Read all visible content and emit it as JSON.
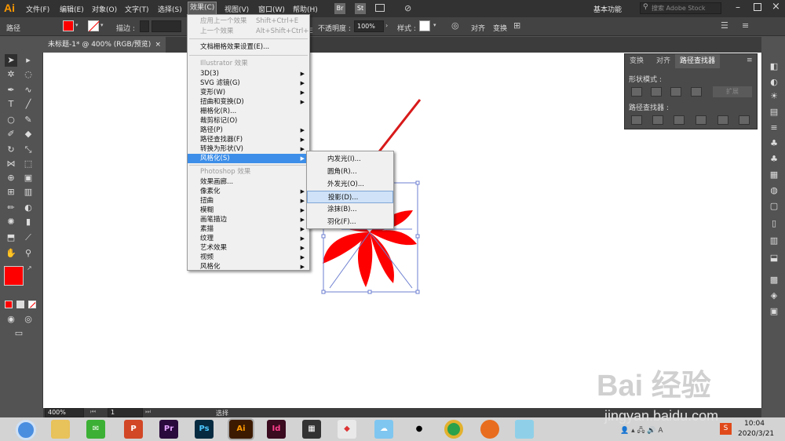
{
  "app": {
    "logo": "Ai"
  },
  "menubar": {
    "items": [
      "文件(F)",
      "编辑(E)",
      "对象(O)",
      "文字(T)",
      "选择(S)",
      "效果(C)",
      "视图(V)",
      "窗口(W)",
      "帮助(H)"
    ],
    "bridge_br": "Br",
    "bridge_st": "St",
    "workspace": "基本功能",
    "search_placeholder": "搜索 Adobe Stock"
  },
  "control": {
    "label": "路径",
    "stroke_label": "描边 :",
    "opacity_label": "不透明度 :",
    "opacity_value": "100%",
    "style_label": "样式 :",
    "align_label": "对齐",
    "transform_label": "变换",
    "fill_color": "#ff0000"
  },
  "document": {
    "tab_title": "未标题-1* @ 400% (RGB/预览)",
    "close": "×"
  },
  "effect_menu": {
    "apply_last": "应用上一个效果",
    "apply_last_sc": "Shift+Ctrl+E",
    "last": "上一个效果",
    "last_sc": "Alt+Shift+Ctrl+E",
    "raster_settings": "文档栅格效果设置(E)...",
    "illustrator_header": "Illustrator 效果",
    "illustrator_items": [
      "3D(3)",
      "SVG 滤镜(G)",
      "变形(W)",
      "扭曲和变换(D)",
      "栅格化(R)...",
      "裁剪标记(O)",
      "路径(P)",
      "路径查找器(F)",
      "转换为形状(V)",
      "风格化(S)"
    ],
    "photoshop_header": "Photoshop 效果",
    "photoshop_items": [
      "效果画廊...",
      "像素化",
      "扭曲",
      "模糊",
      "画笔描边",
      "素描",
      "纹理",
      "艺术效果",
      "视频",
      "风格化"
    ]
  },
  "stylize_submenu": {
    "items": [
      "内发光(I)...",
      "圆角(R)...",
      "外发光(O)...",
      "投影(D)...",
      "涂抹(B)...",
      "羽化(F)..."
    ]
  },
  "pathfinder_panel": {
    "tabs": [
      "变换",
      "对齐",
      "路径查找器"
    ],
    "shape_modes": "形状模式 :",
    "expand": "扩展",
    "pathfinders": "路径查找器 :"
  },
  "statusbar": {
    "zoom": "400%",
    "page": "1",
    "tool": "选择"
  },
  "taskbar": {
    "time": "10:04",
    "date": "2020/3/21",
    "apps": [
      "Pr",
      "Ps",
      "Ai",
      "Id"
    ]
  },
  "watermark": {
    "main": "Bai 经验",
    "sub": "jingyan.baidu.com"
  }
}
